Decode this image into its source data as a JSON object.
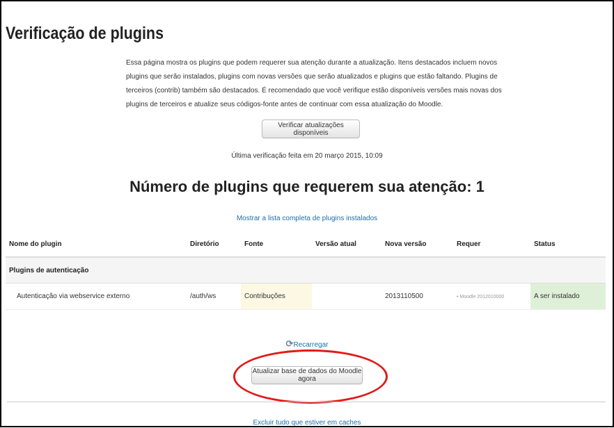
{
  "page": {
    "title": "Verificação de plugins",
    "intro": "Essa página mostra os plugins que podem requerer sua atenção durante a atualização. Itens destacados incluem novos plugins que serão instalados, plugins com novas versões que serão atualizados e plugins que estão faltando. Plugins de terceiros (contrib) também são destacados. É recomendado que você verifique estão disponíveis versões mais novas dos plugins de terceiros e atualize seus códigos-fonte antes de continuar com essa atualização do Moodle.",
    "check_updates_label": "Verificar atualizações disponíveis",
    "last_check": "Última verificação feita em 20 março 2015, 10:09",
    "count_heading": "Número de plugins que requerem sua atenção: 1",
    "show_all_link": "Mostrar a lista completa de plugins instalados"
  },
  "table": {
    "headers": [
      "Nome do plugin",
      "Diretório",
      "Fonte",
      "Versão atual",
      "Nova versão",
      "Requer",
      "Status"
    ],
    "group": "Plugins de autenticação",
    "row": {
      "name": "Autenticação via webservice externo",
      "directory": "/auth/ws",
      "source": "Contribuções",
      "current_version": "",
      "new_version": "2013110500",
      "requires": "• Moodle 2012010000",
      "status": "A ser instalado"
    }
  },
  "actions": {
    "reload_icon": "refresh-icon",
    "reload_label": "Recarregar",
    "upgrade_label": "Atualizar base de dados do Moodle agora",
    "purge_label": "Excluir tudo que estiver em caches"
  },
  "colors": {
    "link": "#1d6fa5",
    "source_highlight": "#fcf8e3",
    "status_highlight": "#dff0d8",
    "annotation_ellipse": "#e01b1b"
  }
}
